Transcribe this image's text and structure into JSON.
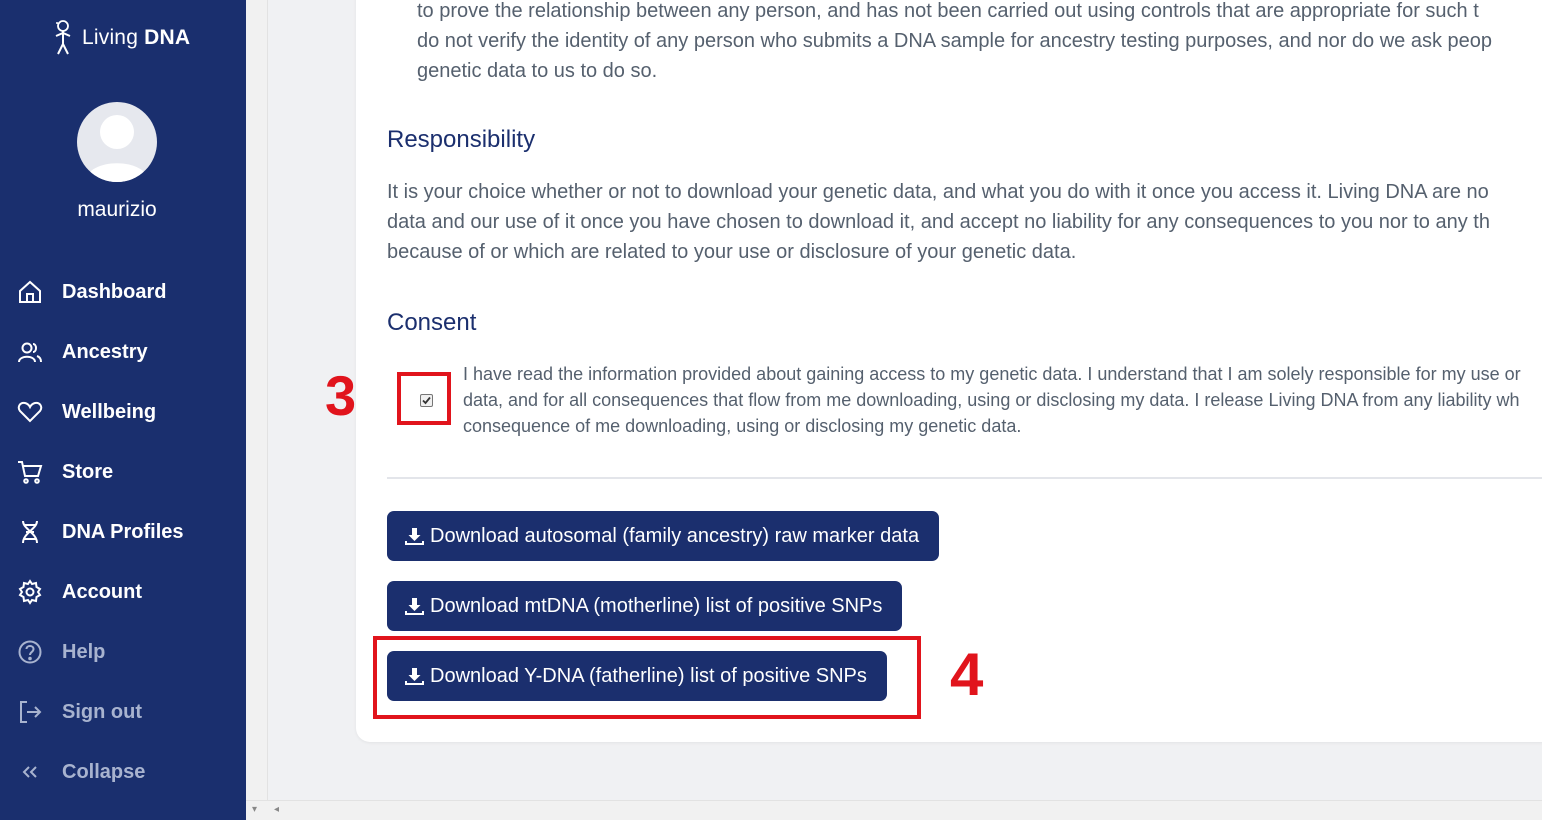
{
  "brand": {
    "living": "Living",
    "dna": "DNA"
  },
  "user": {
    "name": "maurizio"
  },
  "nav": [
    {
      "label": "Dashboard",
      "icon": "home-icon"
    },
    {
      "label": "Ancestry",
      "icon": "people-icon"
    },
    {
      "label": "Wellbeing",
      "icon": "heart-icon"
    },
    {
      "label": "Store",
      "icon": "cart-icon"
    },
    {
      "label": "DNA Profiles",
      "icon": "dna-icon"
    },
    {
      "label": "Account",
      "icon": "gear-icon"
    },
    {
      "label": "Help",
      "icon": "help-icon"
    },
    {
      "label": "Sign out",
      "icon": "sign-out-icon"
    },
    {
      "label": "Collapse",
      "icon": "collapse-icon"
    }
  ],
  "intro": {
    "lines": [
      "to prove the relationship between any person, and has not been carried out using controls that are appropriate for such t",
      "do not verify the identity of any person who submits a DNA sample for ancestry testing purposes, and nor do we ask peop",
      "genetic data to us to do so."
    ]
  },
  "responsibility": {
    "title": "Responsibility",
    "lines": [
      "It is your choice whether or not to download your genetic data, and what you do with it once you access it. Living DNA are no",
      "data and our use of it once you have chosen to download it, and accept no liability for any consequences to you nor to any th",
      "because of or which are related to your use or disclosure of your genetic data."
    ]
  },
  "consent": {
    "title": "Consent",
    "checked": true,
    "lines": [
      "I have read the information provided about gaining access to my genetic data. I understand that I am solely responsible for my use or",
      "data, and for all consequences that flow from me downloading, using or disclosing my data. I release Living DNA from any liability wh",
      "consequence of me downloading, using or disclosing my genetic data."
    ]
  },
  "buttons": {
    "autosomal": "Download autosomal (family ancestry) raw marker data",
    "mtdna": "Download mtDNA (motherline) list of positive SNPs",
    "ydna": "Download Y-DNA (fatherline) list of positive SNPs"
  },
  "annotations": {
    "step3": "3",
    "step4": "4"
  },
  "colors": {
    "sidebar": "#1a2f6e",
    "accent": "#1b2f6e",
    "annotation": "#e1141c"
  }
}
